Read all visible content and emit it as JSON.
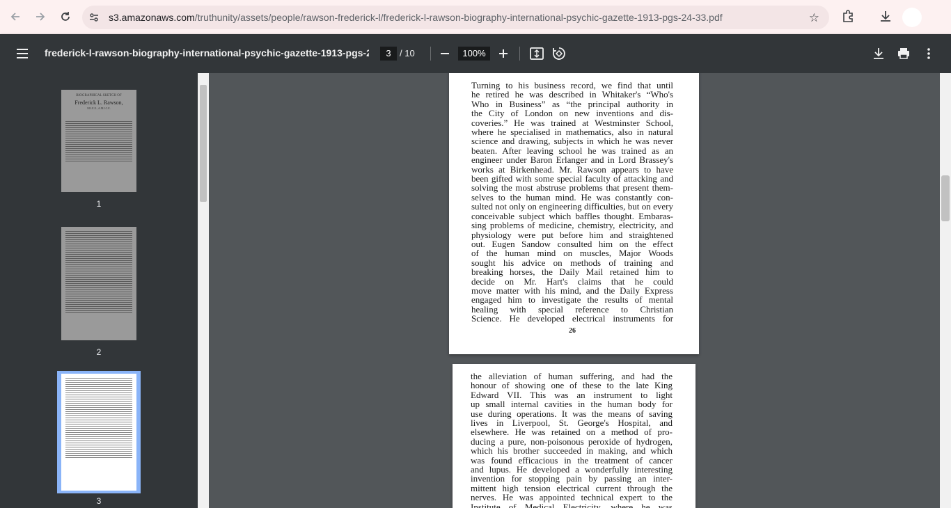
{
  "browser": {
    "url_host": "s3.amazonaws.com",
    "url_path": "/truthunity/assets/people/rawson-frederick-l/frederick-l-rawson-biography-international-psychic-gazette-1913-pgs-24-33.pdf"
  },
  "toolbar": {
    "title": "frederick-l-rawson-biography-international-psychic-gazette-1913-pgs-2...",
    "current_page": "3",
    "total_pages": "/ 10",
    "zoom": "100%"
  },
  "sidebar": {
    "thumbnails": [
      {
        "label": "1"
      },
      {
        "label": "2"
      },
      {
        "label": "3"
      }
    ],
    "thumb1_header": "BIOGRAPHICAL SKETCH OF",
    "thumb1_name": "Frederick L. Rawson,",
    "thumb1_sub": "M.I.E.E., A.M.I.C.E."
  },
  "page_a": {
    "lines": [
      "Turning to his business record, we find that until",
      "he retired he was described in Whitaker's “Who's",
      "Who in Business” as “the principal authority in",
      "the City of London on new inventions and dis-",
      "coveries.”  He was trained at Westminster School,",
      "where he specialised in mathematics, also in natural",
      "science and drawing, subjects in which he was never",
      "beaten.  After leaving school he was trained as an",
      "engineer under Baron Erlanger and in Lord Brassey's",
      "works at Birkenhead.  Mr. Rawson appears to have",
      "been gifted with some special faculty of attacking and",
      "solving the most abstruse problems that present them-",
      "selves to the human mind.  He was constantly con-",
      "sulted not only on engineering difficulties, but on every",
      "conceivable subject which baffles thought.  Embaras-",
      "sing problems of medicine, chemistry, electricity, and",
      "physiology were put before him and straightened",
      "out.  Eugen Sandow consulted him on the effect",
      "of the human mind on muscles, Major Woods",
      "sought his advice on methods of training and",
      "breaking horses, the Daily Mail retained him to",
      "decide on Mr. Hart's claims that he could",
      "move matter with his mind, and the Daily Express",
      "engaged him to investigate the results of mental",
      "healing with special reference to Christian",
      "Science.  He developed electrical instruments for"
    ],
    "page_number": "26"
  },
  "page_b": {
    "lines": [
      "the alleviation of human suffering, and had the",
      "honour of showing one of these to the late King",
      "Edward VII.  This was an instrument to light",
      "up small internal cavities in the human body for",
      "use during operations.  It was the means of saving",
      "lives in Liverpool, St. George's Hospital, and",
      "elsewhere.  He was retained on a method of pro-",
      "ducing a pure, non-poisonous peroxide of hydrogen,",
      "which his brother succeeded in making, and which",
      "was found efficacious in the treatment of cancer",
      "and lupus.  He developed a wonderfully interesting",
      "invention for stopping pain by passing an inter-",
      "mittent high tension electrical current through the",
      "nerves.  He was appointed technical expert to the",
      "Institute of Medical Electricity, where he was"
    ]
  }
}
